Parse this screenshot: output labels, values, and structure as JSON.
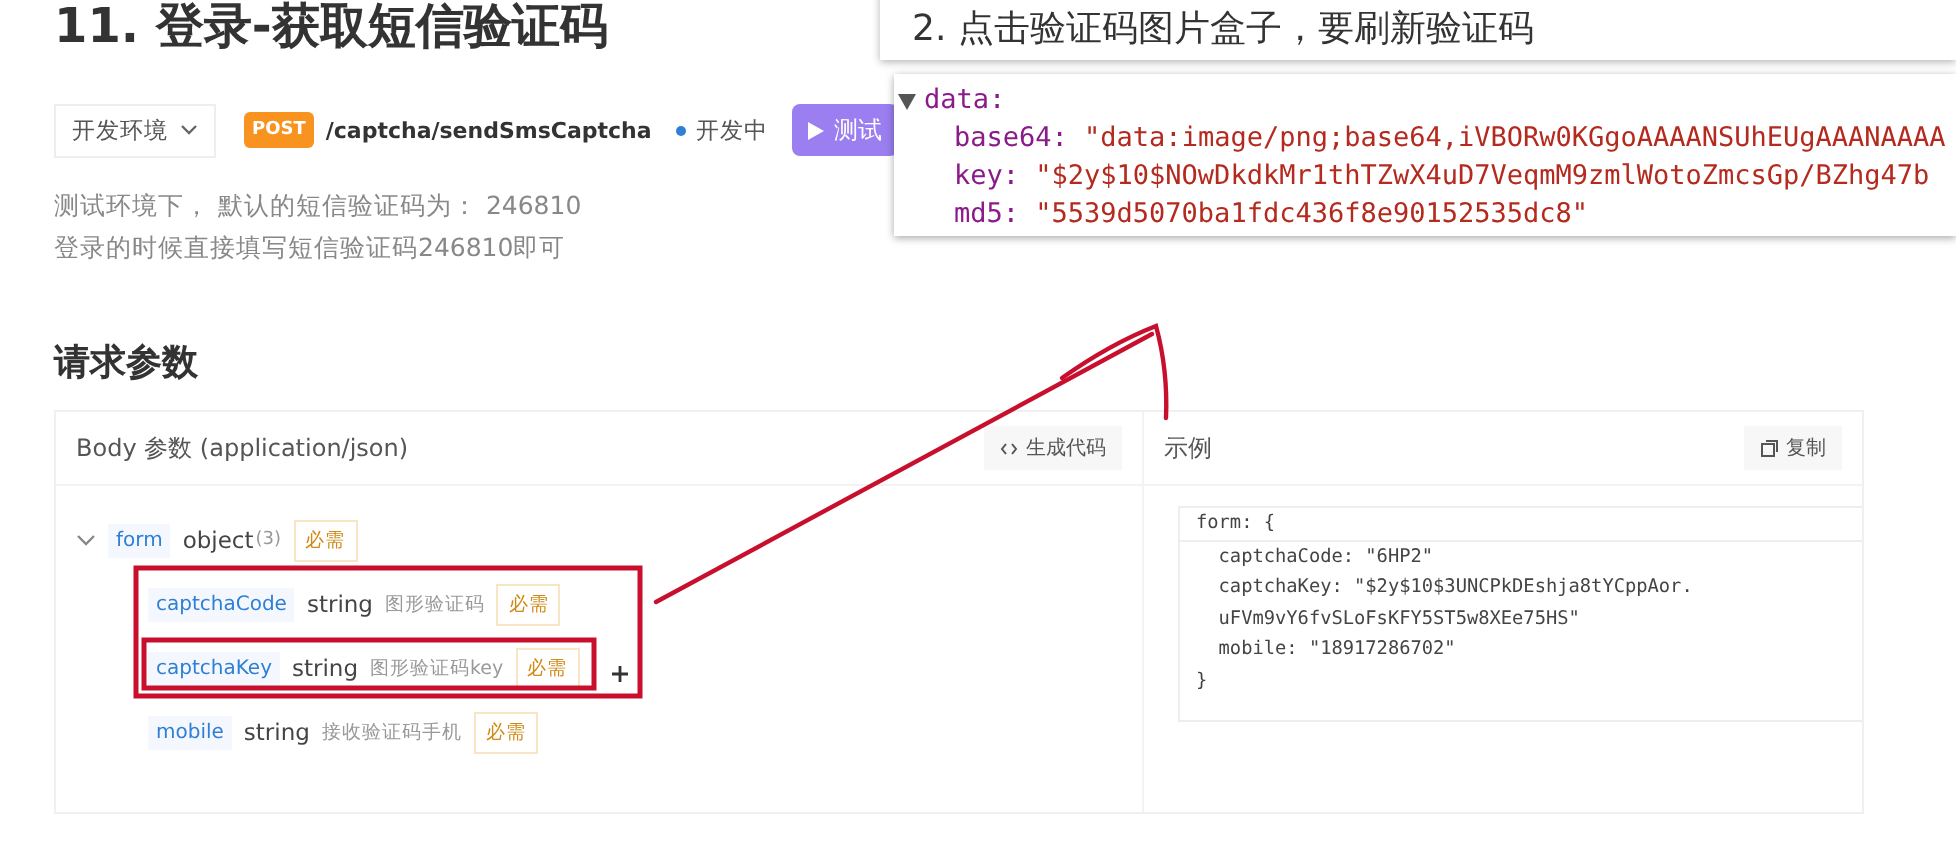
{
  "title": "11. 登录-获取短信验证码",
  "toolbar": {
    "environment": "开发环境",
    "method": "POST",
    "path": "/captcha/sendSmsCaptcha",
    "status": "开发中",
    "test_button": "测试"
  },
  "description": [
    "测试环境下， 默认的短信验证码为： 246810",
    "登录的时候直接填写短信验证码246810即可"
  ],
  "section_title": "请求参数",
  "body_panel": {
    "header": "Body 参数 (application/json)",
    "generate_button": "生成代码",
    "tree": [
      {
        "name": "form",
        "type": "object",
        "count": "(3)",
        "required": "必需",
        "expanded": true,
        "children": [
          {
            "name": "captchaCode",
            "type": "string",
            "description": "图形验证码",
            "required": "必需"
          },
          {
            "name": "captchaKey",
            "type": "string",
            "description": "图形验证码key",
            "required": "必需"
          },
          {
            "name": "mobile",
            "type": "string",
            "description": "接收验证码手机",
            "required": "必需"
          }
        ]
      }
    ]
  },
  "example_panel": {
    "header": "示例",
    "copy_button": "复制",
    "code": [
      "form: {",
      "  captchaCode: \"6HP2\"",
      "  captchaKey: \"$2y$10$3UNCPkDEshja8tYCppAor.",
      "  uFVm9vY6fvSLoFsKFY5ST5w8XEe75HS\"",
      "  mobile: \"18917286702\"",
      "}"
    ]
  },
  "annotation_note": "2. 点击验证码图片盒子，要刷新验证码",
  "devtools": {
    "object": "data:",
    "expanded": true,
    "properties": [
      {
        "key": "base64:",
        "value": "\"data:image/png;base64,iVBORw0KGgoAAAANSUhEUgAAANAAAA"
      },
      {
        "key": "key:",
        "value": "\"$2y$10$NOwDkdkMr1thTZwX4uD7VeqmM9zmlWotoZmcsGp/BZhg47b"
      },
      {
        "key": "md5:",
        "value": "\"5539d5070ba1fdc436f8e90152535dc8\""
      }
    ]
  }
}
